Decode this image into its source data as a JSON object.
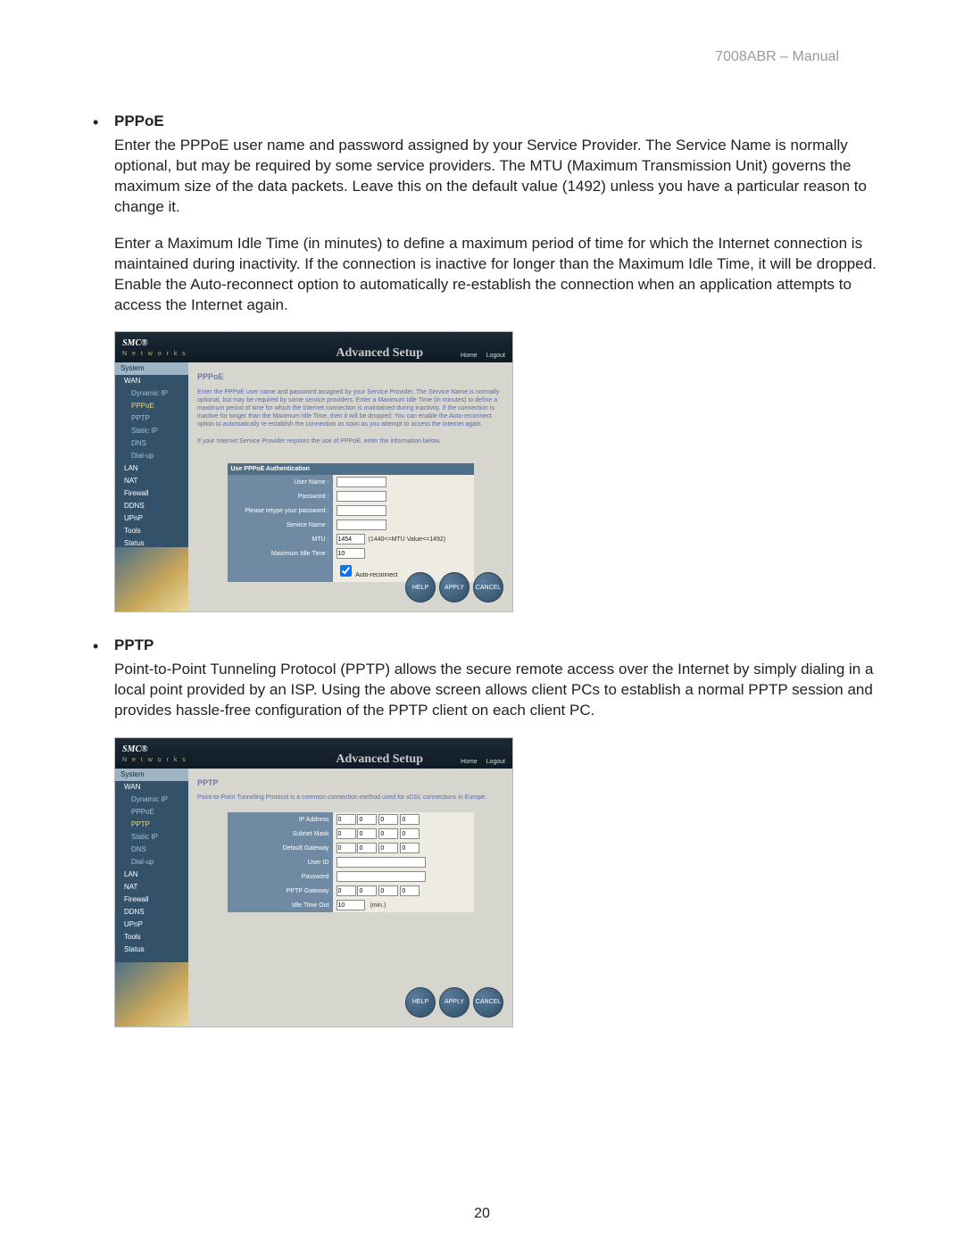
{
  "header": "7008ABR – Manual",
  "pageNumber": "20",
  "pppoe": {
    "title": "PPPoE",
    "p1": "Enter the PPPoE user name and password assigned by your Service Provider. The Service Name is normally optional, but may be required by some service providers. The MTU (Maximum Transmission Unit) governs the maximum size of the data packets. Leave this on the default value (1492) unless you have a particular reason to change it.",
    "p2": "Enter a Maximum Idle Time (in minutes) to define a maximum period of time for which the Internet connection is maintained during inactivity. If the connection is inactive for longer than the Maximum Idle Time, it will be dropped. Enable the Auto-reconnect option to automatically re-establish the connection when an application attempts to access the Internet again."
  },
  "pptp": {
    "title": "PPTP",
    "p1": "Point-to-Point Tunneling Protocol (PPTP) allows the secure remote access over the Internet by simply dialing in a local point provided by an ISP. Using the above screen allows client PCs to establish a normal PPTP session and provides hassle-free configuration of the PPTP client on each client PC."
  },
  "shot": {
    "logo": "SMC",
    "logoSup": "®",
    "networks": "N e t w o r k s",
    "advanced": "Advanced Setup",
    "homeBtn": "Home",
    "logoutBtn": "Logout",
    "sideOrder": [
      "System",
      "WAN",
      "Dynamic IP",
      "PPPoE",
      "PPTP",
      "Static IP",
      "DNS",
      "Dial-up",
      "LAN",
      "NAT",
      "Firewall",
      "DDNS",
      "UPnP",
      "Tools",
      "Status"
    ],
    "help": "HELP",
    "apply": "APPLY",
    "cancel": "CANCEL"
  },
  "pppoePane": {
    "title": "PPPoE",
    "desc": "Enter the PPPoE user name and password assigned by your Service Provider. The Service Name is normally optional, but may be required by some service providers. Enter a Maximum Idle Time (in minutes) to define a maximum period of time for which the Internet connection is maintained during inactivity. If the connection is inactive for longer than the Maximum Idle Time, then it will be dropped. You can enable the Auto-reconnect option to automatically re-establish the connection as soon as you attempt to access the Internet again.",
    "note": "If your Internet Service Provider requires the use of PPPoE, enter the information below.",
    "formHeader": "Use PPPoE Authentication",
    "labels": {
      "user": "User Name :",
      "pass": "Password :",
      "retype": "Please retype your password :",
      "service": "Service Name :",
      "mtu": "MTU :",
      "idle": "Maximum Idle Time :"
    },
    "values": {
      "mtu": "1454",
      "idle": "10"
    },
    "mtuRange": "(1440<=MTU Value<=1492)",
    "auto": "Auto-reconnect"
  },
  "pptpPane": {
    "title": "PPTP",
    "desc": "Point-to-Point Tunneling Protocol is a common connection method used for xDSL connections in Europe.",
    "labels": {
      "ip": "IP Address",
      "mask": "Subnet Mask",
      "gw": "Default Gateway",
      "user": "User ID",
      "pass": "Password",
      "pgw": "PPTP Gateway",
      "idle": "Idle Time Out"
    },
    "values": {
      "oct": "0",
      "idle": "10",
      "idleUnit": "(min.)"
    }
  }
}
